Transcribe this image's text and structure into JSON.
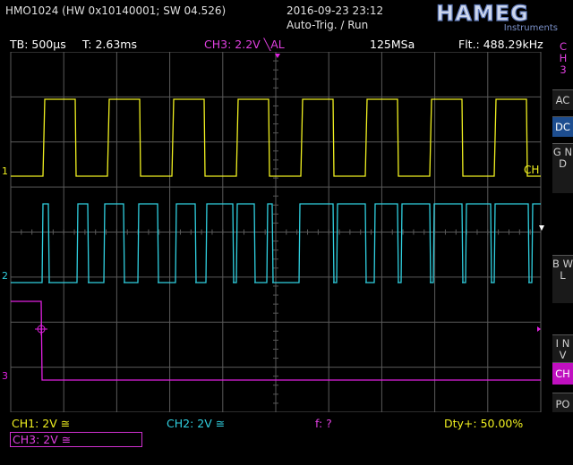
{
  "header": {
    "device": "HMO1024 (HW 0x10140001; SW 04.526)",
    "datetime": "2016-09-23 23:12",
    "mode": "Auto-Trig. / Run",
    "brand": "HAMEG",
    "brand_sub": "Instruments"
  },
  "infobar": {
    "timebase": "TB: 500µs",
    "trigger_time": "T: 2.63ms",
    "trigger_channel": "CH3: 2.2V ╲AL",
    "sample_rate": "125MSa",
    "filter": "Flt.: 488.29kHz"
  },
  "sidebar": {
    "channel_label": "C H 3",
    "buttons": [
      {
        "label": "AC",
        "selected": false
      },
      {
        "label": "DC",
        "selected": true
      },
      {
        "label": "G N D",
        "selected": false
      },
      {
        "label": "B W L",
        "selected": false
      },
      {
        "label": "I N V",
        "selected": false
      },
      {
        "label": "CH",
        "selected": false
      },
      {
        "label": "PO",
        "selected": false
      }
    ]
  },
  "markers": {
    "ch1": "1",
    "ch2": "2",
    "ch3": "3",
    "ch1_end": "CH"
  },
  "bottom": {
    "ch1": "CH1: 2V ≅",
    "ch2": "CH2: 2V ≅",
    "freq": "f: ?",
    "duty": "Dty+: 50.00%",
    "ch3": "CH3: 2V ≅"
  },
  "colors": {
    "ch1": "#f0f020",
    "ch2": "#30d0e0",
    "ch3": "#e020e0",
    "grid": "#5a5a5a"
  }
}
